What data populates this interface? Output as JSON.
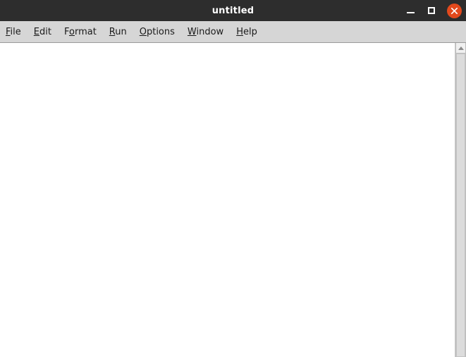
{
  "window": {
    "title": "untitled",
    "colors": {
      "titlebar_bg": "#2d2d2d",
      "titlebar_fg": "#ffffff",
      "menubar_bg": "#d6d6d6",
      "close_button": "#e3491c",
      "editor_bg": "#ffffff",
      "scrollbar_thumb": "#dcdcdc"
    }
  },
  "titlebar": {
    "minimize_label": "–",
    "maximize_label": "□",
    "close_label": "✕",
    "minimize_icon": "minimize-icon",
    "maximize_icon": "maximize-icon",
    "close_icon": "close-icon"
  },
  "menubar": {
    "items": [
      {
        "label": "File",
        "mnemonic_index": 0
      },
      {
        "label": "Edit",
        "mnemonic_index": 0
      },
      {
        "label": "Format",
        "mnemonic_index": 1
      },
      {
        "label": "Run",
        "mnemonic_index": 0
      },
      {
        "label": "Options",
        "mnemonic_index": 0
      },
      {
        "label": "Window",
        "mnemonic_index": 0
      },
      {
        "label": "Help",
        "mnemonic_index": 0
      }
    ]
  },
  "editor": {
    "content": "",
    "placeholder": ""
  },
  "scrollbar": {
    "up_arrow_icon": "scroll-up-arrow-icon",
    "thumb_position_percent": 0,
    "thumb_size_percent": 100
  }
}
